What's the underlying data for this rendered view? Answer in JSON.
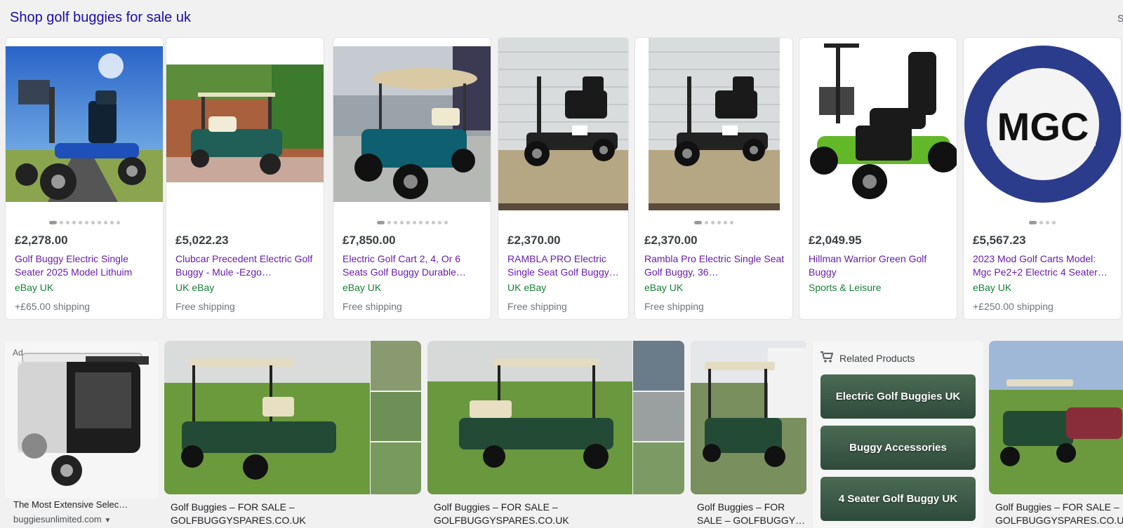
{
  "header": {
    "title": "Shop golf buggies for sale uk",
    "edge_text": "S"
  },
  "products": [
    {
      "price": "£2,278.00",
      "title": "Golf Buggy Electric Single Seater 2025 Model Lithuim",
      "merchant": "eBay UK",
      "shipping": "+£65.00 shipping",
      "dots": 11,
      "active_dot": 0
    },
    {
      "price": "£5,022.23",
      "title": "Clubcar Precedent Electric Golf Buggy - Mule -Ezgo…",
      "merchant": "UK eBay",
      "shipping": "Free shipping",
      "dots": 0,
      "active_dot": 0
    },
    {
      "price": "£7,850.00",
      "title": "Electric Golf Cart 2, 4, Or 6 Seats Golf Buggy Durable…",
      "merchant": "eBay UK",
      "shipping": "Free shipping",
      "dots": 11,
      "active_dot": 0
    },
    {
      "price": "£2,370.00",
      "title": "RAMBLA PRO Electric Single Seat Golf Buggy…",
      "merchant": "UK eBay",
      "shipping": "Free shipping",
      "dots": 0,
      "active_dot": 0
    },
    {
      "price": "£2,370.00",
      "title": "Rambla Pro Electric Single Seat Golf Buggy, 36…",
      "merchant": "eBay UK",
      "shipping": "Free shipping",
      "dots": 6,
      "active_dot": 0
    },
    {
      "price": "£2,049.95",
      "title": "Hillman Warrior Green Golf Buggy",
      "merchant": "Sports & Leisure",
      "shipping": "",
      "dots": 0,
      "active_dot": 0
    },
    {
      "price": "£5,567.23",
      "title": "2023 Mod Golf Carts Model: Mgc Pe2+2 Electric 4 Seater…",
      "merchant": "eBay UK",
      "shipping": "+£250.00 shipping",
      "dots": 4,
      "active_dot": 0,
      "logo_text": "MGC"
    }
  ],
  "ad": {
    "label": "Ad",
    "caption": "The Most Extensive Selec…",
    "domain": "buggiesunlimited.com"
  },
  "gallery": [
    {
      "caption_line1": "Golf Buggies – FOR SALE –",
      "caption_line2": "GOLFBUGGYSPARES.CO.UK"
    },
    {
      "caption_line1": "Golf Buggies – FOR SALE –",
      "caption_line2": "GOLFBUGGYSPARES.CO.UK"
    },
    {
      "caption_line1": "Golf Buggies – FOR",
      "caption_line2": "SALE – GOLFBUGGY…"
    },
    {
      "caption_line1": "Golf Buggies – FOR SALE –",
      "caption_line2": "GOLFBUGGYSPARES.CO.UK"
    }
  ],
  "related": {
    "title": "Related Products",
    "items": [
      "Electric Golf Buggies UK",
      "Buggy Accessories",
      "4 Seater Golf Buggy UK"
    ]
  },
  "icons": [
    "cart-icon",
    "chevron-down-icon"
  ]
}
